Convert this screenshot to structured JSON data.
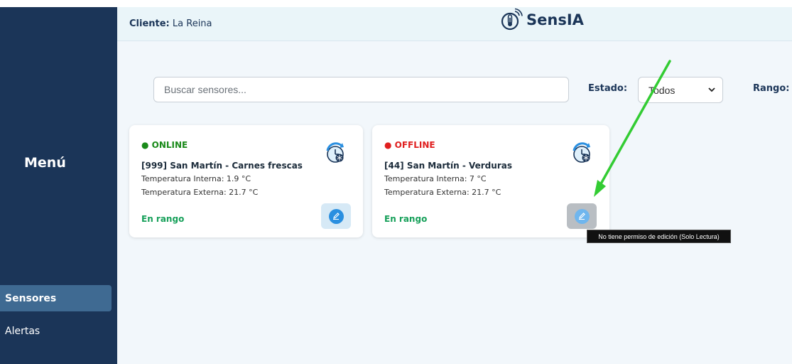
{
  "sidebar": {
    "menu_title": "Menú",
    "items": [
      {
        "label": "Sensores",
        "active": true
      },
      {
        "label": "Alertas",
        "active": false
      }
    ]
  },
  "header": {
    "client_label": "Cliente:",
    "client_name": "La Reina",
    "brand": "SensIA"
  },
  "filters": {
    "search_placeholder": "Buscar sensores...",
    "estado_label": "Estado:",
    "estado_value": "Todos",
    "rango_label": "Rango:"
  },
  "cards": [
    {
      "status": "● ONLINE",
      "title": "[999] San Martín - Carnes frescas",
      "temp_int": "Temperatura Interna: 1.9 °C",
      "temp_ext": "Temperatura Externa: 21.7 °C",
      "range": "En rango"
    },
    {
      "status": "● OFFLINE",
      "title": "[44] San Martín - Verduras",
      "temp_int": "Temperatura Interna: 7 °C",
      "temp_ext": "Temperatura Externa: 21.7 °C",
      "range": "En rango"
    }
  ],
  "tooltip": "No tiene permiso de edición (Solo Lectura)",
  "colors": {
    "sidebar": "#1b3558",
    "online": "#1a8a1a",
    "offline": "#e01f1f",
    "in_range": "#17a05a",
    "annotation_arrow": "#33cc33"
  }
}
